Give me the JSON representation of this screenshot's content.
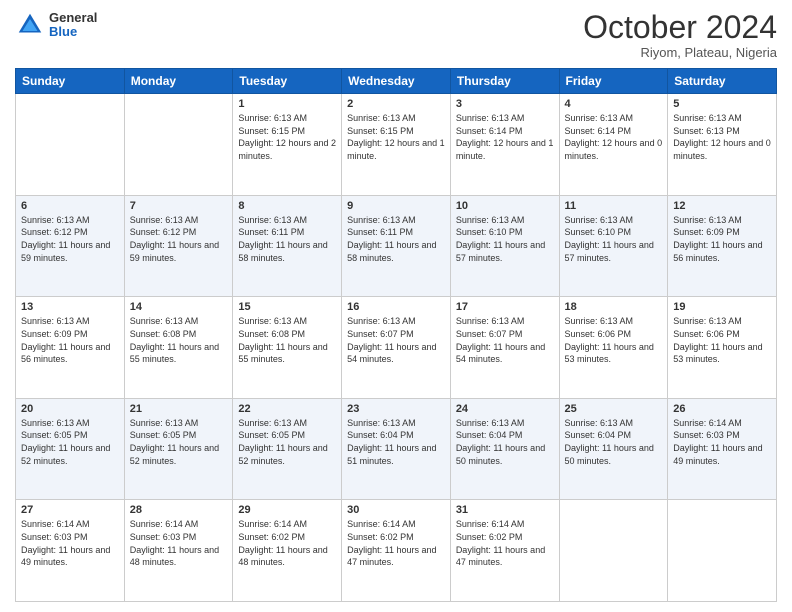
{
  "header": {
    "logo_general": "General",
    "logo_blue": "Blue",
    "month": "October 2024",
    "location": "Riyom, Plateau, Nigeria"
  },
  "days_of_week": [
    "Sunday",
    "Monday",
    "Tuesday",
    "Wednesday",
    "Thursday",
    "Friday",
    "Saturday"
  ],
  "weeks": [
    [
      {
        "day": "",
        "sunrise": "",
        "sunset": "",
        "daylight": ""
      },
      {
        "day": "",
        "sunrise": "",
        "sunset": "",
        "daylight": ""
      },
      {
        "day": "1",
        "sunrise": "Sunrise: 6:13 AM",
        "sunset": "Sunset: 6:15 PM",
        "daylight": "Daylight: 12 hours and 2 minutes."
      },
      {
        "day": "2",
        "sunrise": "Sunrise: 6:13 AM",
        "sunset": "Sunset: 6:15 PM",
        "daylight": "Daylight: 12 hours and 1 minute."
      },
      {
        "day": "3",
        "sunrise": "Sunrise: 6:13 AM",
        "sunset": "Sunset: 6:14 PM",
        "daylight": "Daylight: 12 hours and 1 minute."
      },
      {
        "day": "4",
        "sunrise": "Sunrise: 6:13 AM",
        "sunset": "Sunset: 6:14 PM",
        "daylight": "Daylight: 12 hours and 0 minutes."
      },
      {
        "day": "5",
        "sunrise": "Sunrise: 6:13 AM",
        "sunset": "Sunset: 6:13 PM",
        "daylight": "Daylight: 12 hours and 0 minutes."
      }
    ],
    [
      {
        "day": "6",
        "sunrise": "Sunrise: 6:13 AM",
        "sunset": "Sunset: 6:12 PM",
        "daylight": "Daylight: 11 hours and 59 minutes."
      },
      {
        "day": "7",
        "sunrise": "Sunrise: 6:13 AM",
        "sunset": "Sunset: 6:12 PM",
        "daylight": "Daylight: 11 hours and 59 minutes."
      },
      {
        "day": "8",
        "sunrise": "Sunrise: 6:13 AM",
        "sunset": "Sunset: 6:11 PM",
        "daylight": "Daylight: 11 hours and 58 minutes."
      },
      {
        "day": "9",
        "sunrise": "Sunrise: 6:13 AM",
        "sunset": "Sunset: 6:11 PM",
        "daylight": "Daylight: 11 hours and 58 minutes."
      },
      {
        "day": "10",
        "sunrise": "Sunrise: 6:13 AM",
        "sunset": "Sunset: 6:10 PM",
        "daylight": "Daylight: 11 hours and 57 minutes."
      },
      {
        "day": "11",
        "sunrise": "Sunrise: 6:13 AM",
        "sunset": "Sunset: 6:10 PM",
        "daylight": "Daylight: 11 hours and 57 minutes."
      },
      {
        "day": "12",
        "sunrise": "Sunrise: 6:13 AM",
        "sunset": "Sunset: 6:09 PM",
        "daylight": "Daylight: 11 hours and 56 minutes."
      }
    ],
    [
      {
        "day": "13",
        "sunrise": "Sunrise: 6:13 AM",
        "sunset": "Sunset: 6:09 PM",
        "daylight": "Daylight: 11 hours and 56 minutes."
      },
      {
        "day": "14",
        "sunrise": "Sunrise: 6:13 AM",
        "sunset": "Sunset: 6:08 PM",
        "daylight": "Daylight: 11 hours and 55 minutes."
      },
      {
        "day": "15",
        "sunrise": "Sunrise: 6:13 AM",
        "sunset": "Sunset: 6:08 PM",
        "daylight": "Daylight: 11 hours and 55 minutes."
      },
      {
        "day": "16",
        "sunrise": "Sunrise: 6:13 AM",
        "sunset": "Sunset: 6:07 PM",
        "daylight": "Daylight: 11 hours and 54 minutes."
      },
      {
        "day": "17",
        "sunrise": "Sunrise: 6:13 AM",
        "sunset": "Sunset: 6:07 PM",
        "daylight": "Daylight: 11 hours and 54 minutes."
      },
      {
        "day": "18",
        "sunrise": "Sunrise: 6:13 AM",
        "sunset": "Sunset: 6:06 PM",
        "daylight": "Daylight: 11 hours and 53 minutes."
      },
      {
        "day": "19",
        "sunrise": "Sunrise: 6:13 AM",
        "sunset": "Sunset: 6:06 PM",
        "daylight": "Daylight: 11 hours and 53 minutes."
      }
    ],
    [
      {
        "day": "20",
        "sunrise": "Sunrise: 6:13 AM",
        "sunset": "Sunset: 6:05 PM",
        "daylight": "Daylight: 11 hours and 52 minutes."
      },
      {
        "day": "21",
        "sunrise": "Sunrise: 6:13 AM",
        "sunset": "Sunset: 6:05 PM",
        "daylight": "Daylight: 11 hours and 52 minutes."
      },
      {
        "day": "22",
        "sunrise": "Sunrise: 6:13 AM",
        "sunset": "Sunset: 6:05 PM",
        "daylight": "Daylight: 11 hours and 52 minutes."
      },
      {
        "day": "23",
        "sunrise": "Sunrise: 6:13 AM",
        "sunset": "Sunset: 6:04 PM",
        "daylight": "Daylight: 11 hours and 51 minutes."
      },
      {
        "day": "24",
        "sunrise": "Sunrise: 6:13 AM",
        "sunset": "Sunset: 6:04 PM",
        "daylight": "Daylight: 11 hours and 50 minutes."
      },
      {
        "day": "25",
        "sunrise": "Sunrise: 6:13 AM",
        "sunset": "Sunset: 6:04 PM",
        "daylight": "Daylight: 11 hours and 50 minutes."
      },
      {
        "day": "26",
        "sunrise": "Sunrise: 6:14 AM",
        "sunset": "Sunset: 6:03 PM",
        "daylight": "Daylight: 11 hours and 49 minutes."
      }
    ],
    [
      {
        "day": "27",
        "sunrise": "Sunrise: 6:14 AM",
        "sunset": "Sunset: 6:03 PM",
        "daylight": "Daylight: 11 hours and 49 minutes."
      },
      {
        "day": "28",
        "sunrise": "Sunrise: 6:14 AM",
        "sunset": "Sunset: 6:03 PM",
        "daylight": "Daylight: 11 hours and 48 minutes."
      },
      {
        "day": "29",
        "sunrise": "Sunrise: 6:14 AM",
        "sunset": "Sunset: 6:02 PM",
        "daylight": "Daylight: 11 hours and 48 minutes."
      },
      {
        "day": "30",
        "sunrise": "Sunrise: 6:14 AM",
        "sunset": "Sunset: 6:02 PM",
        "daylight": "Daylight: 11 hours and 47 minutes."
      },
      {
        "day": "31",
        "sunrise": "Sunrise: 6:14 AM",
        "sunset": "Sunset: 6:02 PM",
        "daylight": "Daylight: 11 hours and 47 minutes."
      },
      {
        "day": "",
        "sunrise": "",
        "sunset": "",
        "daylight": ""
      },
      {
        "day": "",
        "sunrise": "",
        "sunset": "",
        "daylight": ""
      }
    ]
  ]
}
